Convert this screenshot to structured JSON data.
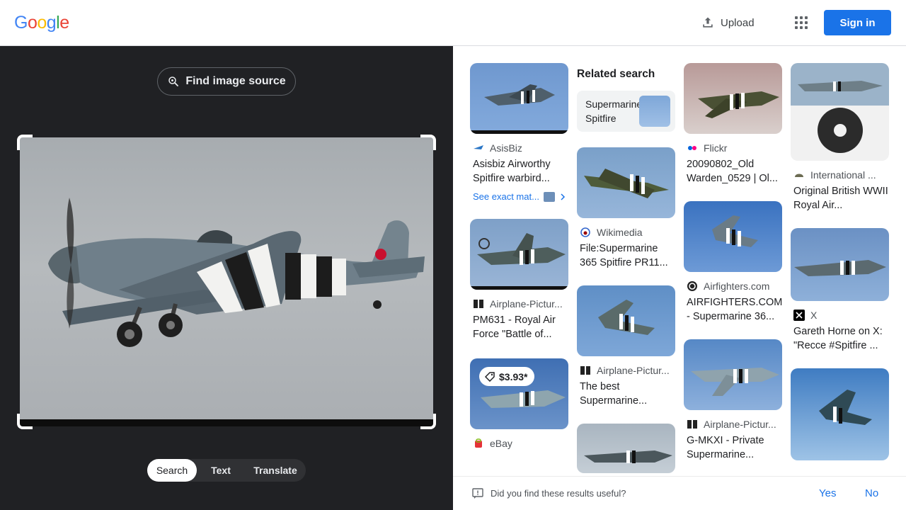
{
  "header": {
    "logo": [
      "G",
      "o",
      "o",
      "g",
      "l",
      "e"
    ],
    "logo_colors": [
      "#4285F4",
      "#EA4335",
      "#FBBC05",
      "#4285F4",
      "#34A853",
      "#EA4335"
    ],
    "upload_label": "Upload",
    "signin_label": "Sign in"
  },
  "left": {
    "find_source_label": "Find image source",
    "tabs": [
      "Search",
      "Text",
      "Translate"
    ],
    "active_tab": "Search"
  },
  "results": {
    "related_search_title": "Related search",
    "related_search_item": "Supermarine Spitfire",
    "see_exact_matches": "See exact mat...",
    "price": "$3.93*",
    "cards": [
      {
        "source": "AsisBiz",
        "title": "Asisbiz Airworthy Spitfire warbird..."
      },
      {
        "source": "Airplane-Pictur...",
        "title": "PM631 - Royal Air Force \"Battle of..."
      },
      {
        "source": "eBay",
        "title": "..."
      },
      {
        "source": "Wikimedia",
        "title": "File:Supermarine 365 Spitfire PR11..."
      },
      {
        "source": "Airplane-Pictur...",
        "title": "The best Supermarine..."
      },
      {
        "source": "Flickr",
        "title": "20090802_Old Warden_0529 | Ol..."
      },
      {
        "source": "Airfighters.com",
        "title": "AIRFIGHTERS.COM - Supermarine 36..."
      },
      {
        "source": "Airplane-Pictur...",
        "title": "G-MKXI - Private Supermarine..."
      },
      {
        "source": "International ...",
        "title": "Original British WWII Royal Air..."
      },
      {
        "source": "X",
        "title": "Gareth Horne on X: \"Recce #Spitfire ..."
      }
    ]
  },
  "feedback": {
    "question": "Did you find these results useful?",
    "yes": "Yes",
    "no": "No"
  }
}
